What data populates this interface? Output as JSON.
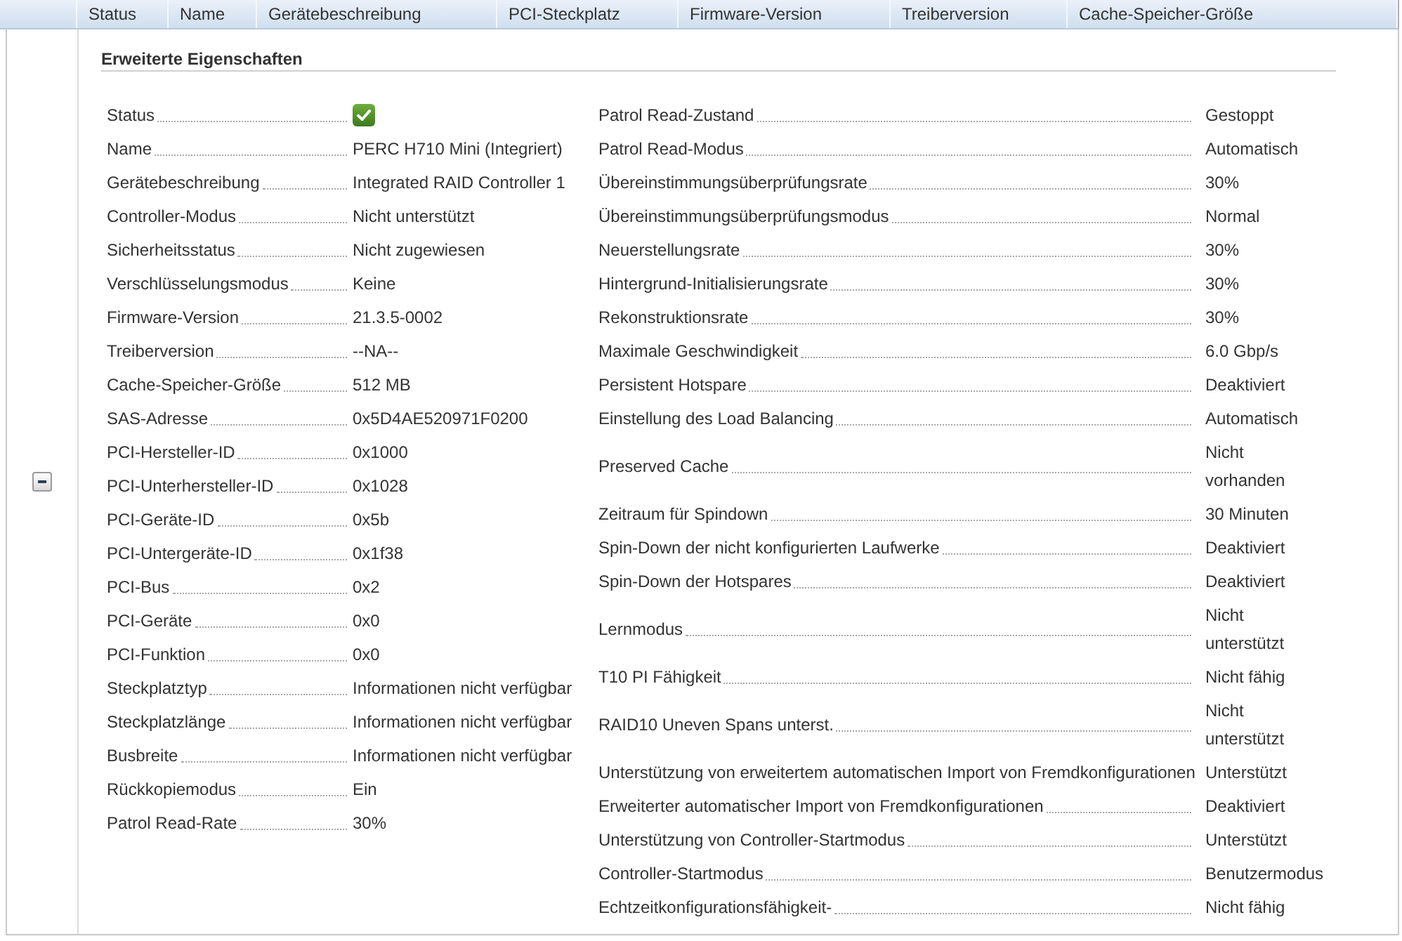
{
  "table": {
    "columns": [
      {
        "label": "Status"
      },
      {
        "label": "Name"
      },
      {
        "label": "Gerätebeschreibung"
      },
      {
        "label": "PCI-Steckplatz"
      },
      {
        "label": "Firmware-Version"
      },
      {
        "label": "Treiberversion"
      },
      {
        "label": "Cache-Speicher-Größe"
      }
    ]
  },
  "row": {
    "expanded": true
  },
  "details": {
    "title": "Erweiterte Eigenschaften",
    "left": [
      {
        "kind": "status",
        "label": "Status",
        "healthy": true
      },
      {
        "kind": "text",
        "label": "Name",
        "value": "PERC H710 Mini (Integriert)"
      },
      {
        "kind": "text",
        "label": "Gerätebeschreibung",
        "value": "Integrated RAID Controller 1"
      },
      {
        "kind": "text",
        "label": "Controller-Modus",
        "value": "Nicht unterstützt"
      },
      {
        "kind": "text",
        "label": "Sicherheitsstatus",
        "value": "Nicht zugewiesen"
      },
      {
        "kind": "text",
        "label": "Verschlüsselungsmodus",
        "value": "Keine"
      },
      {
        "kind": "text",
        "label": "Firmware-Version",
        "value": "21.3.5-0002"
      },
      {
        "kind": "text",
        "label": "Treiberversion",
        "value": "--NA--"
      },
      {
        "kind": "text",
        "label": "Cache-Speicher-Größe",
        "value": "512 MB"
      },
      {
        "kind": "text",
        "label": "SAS-Adresse",
        "value": "0x5D4AE520971F0200"
      },
      {
        "kind": "text",
        "label": "PCI-Hersteller-ID",
        "value": "0x1000"
      },
      {
        "kind": "text",
        "label": "PCI-Unterhersteller-ID",
        "value": "0x1028"
      },
      {
        "kind": "text",
        "label": "PCI-Geräte-ID",
        "value": "0x5b"
      },
      {
        "kind": "text",
        "label": "PCI-Untergeräte-ID",
        "value": "0x1f38"
      },
      {
        "kind": "text",
        "label": "PCI-Bus",
        "value": "0x2"
      },
      {
        "kind": "text",
        "label": "PCI-Geräte",
        "value": "0x0"
      },
      {
        "kind": "text",
        "label": "PCI-Funktion",
        "value": "0x0"
      },
      {
        "kind": "text",
        "label": "Steckplatztyp",
        "value": "Informationen nicht verfügbar"
      },
      {
        "kind": "text",
        "label": "Steckplatzlänge",
        "value": "Informationen nicht verfügbar"
      },
      {
        "kind": "text",
        "label": "Busbreite",
        "value": "Informationen nicht verfügbar"
      },
      {
        "kind": "text",
        "label": "Rückkopiemodus",
        "value": "Ein"
      },
      {
        "kind": "text",
        "label": "Patrol Read-Rate",
        "value": "30%"
      }
    ],
    "right": [
      {
        "kind": "text",
        "label": "Patrol Read-Zustand",
        "value": "Gestoppt"
      },
      {
        "kind": "text",
        "label": "Patrol Read-Modus",
        "value": "Automatisch"
      },
      {
        "kind": "text",
        "label": "Übereinstimmungsüberprüfungsrate",
        "value": "30%"
      },
      {
        "kind": "text",
        "label": "Übereinstimmungsüberprüfungsmodus",
        "value": "Normal"
      },
      {
        "kind": "text",
        "label": "Neuerstellungsrate",
        "value": "30%"
      },
      {
        "kind": "text",
        "label": "Hintergrund-Initialisierungsrate",
        "value": "30%"
      },
      {
        "kind": "text",
        "label": "Rekonstruktionsrate",
        "value": "30%"
      },
      {
        "kind": "text",
        "label": "Maximale Geschwindigkeit",
        "value": "6.0 Gbp/s"
      },
      {
        "kind": "text",
        "label": "Persistent Hotspare",
        "value": "Deaktiviert"
      },
      {
        "kind": "text",
        "label": "Einstellung des Load Balancing",
        "value": "Automatisch"
      },
      {
        "kind": "text",
        "label": "Preserved Cache",
        "value": "Nicht vorhanden"
      },
      {
        "kind": "text",
        "label": "Zeitraum für Spindown",
        "value": "30 Minuten"
      },
      {
        "kind": "text",
        "label": "Spin-Down der nicht konfigurierten Laufwerke",
        "value": "Deaktiviert"
      },
      {
        "kind": "text",
        "label": "Spin-Down der Hotspares",
        "value": "Deaktiviert"
      },
      {
        "kind": "text",
        "label": "Lernmodus",
        "value": "Nicht unterstützt"
      },
      {
        "kind": "text",
        "label": "T10 PI Fähigkeit",
        "value": "Nicht fähig"
      },
      {
        "kind": "text",
        "label": "RAID10 Uneven Spans unterst.",
        "value": "Nicht unterstützt"
      },
      {
        "kind": "text",
        "label": "Unterstützung von erweitertem automatischen Import von Fremdkonfigurationen",
        "value": "Unterstützt"
      },
      {
        "kind": "text",
        "label": "Erweiterter automatischer Import von Fremdkonfigurationen",
        "value": "Deaktiviert"
      },
      {
        "kind": "text",
        "label": "Unterstützung von Controller-Startmodus",
        "value": "Unterstützt"
      },
      {
        "kind": "text",
        "label": "Controller-Startmodus",
        "value": "Benutzermodus"
      },
      {
        "kind": "text",
        "label": "Echtzeitkonfigurationsfähigkeit-",
        "value": "Nicht fähig"
      }
    ]
  }
}
